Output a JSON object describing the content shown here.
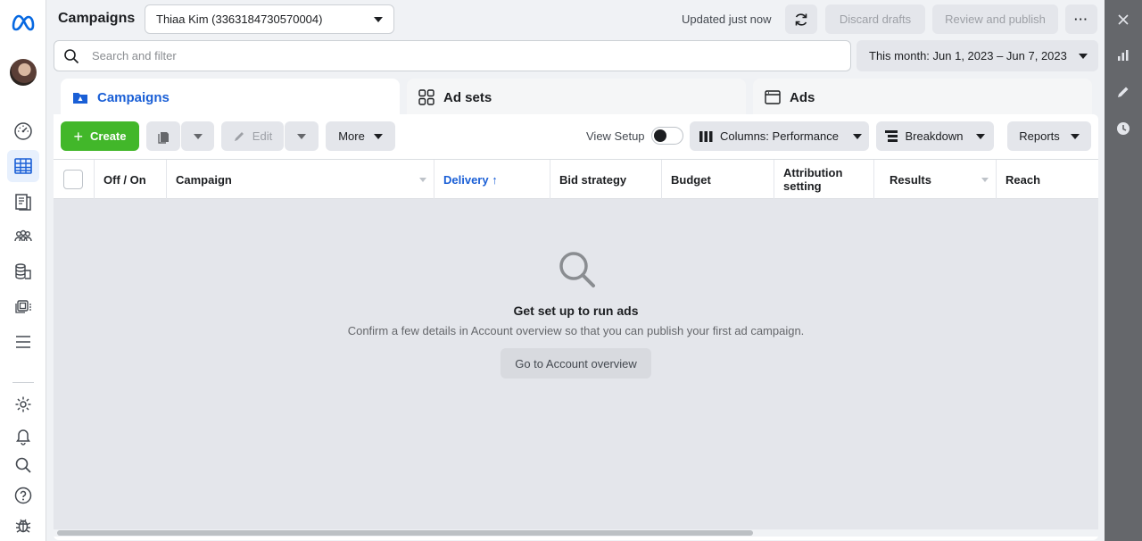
{
  "app": {
    "title": "Campaigns"
  },
  "topbar": {
    "account": "Thiaa Kim (3363184730570004)",
    "status": "Updated just now",
    "discard_label": "Discard drafts",
    "review_label": "Review and publish",
    "more_label": "···"
  },
  "search": {
    "placeholder": "Search and filter"
  },
  "date_range": "This month: Jun 1, 2023 – Jun 7, 2023",
  "tabs": [
    {
      "label": "Campaigns",
      "active": true
    },
    {
      "label": "Ad sets",
      "active": false
    },
    {
      "label": "Ads",
      "active": false
    }
  ],
  "toolbar": {
    "create_label": "Create",
    "edit_label": "Edit",
    "more_label": "More",
    "view_setup_label": "View Setup",
    "columns_label": "Columns: Performance",
    "breakdown_label": "Breakdown",
    "reports_label": "Reports"
  },
  "table": {
    "columns": [
      "Off / On",
      "Campaign",
      "Delivery ↑",
      "Bid strategy",
      "Budget",
      "Attribution setting",
      "Results",
      "Reach"
    ],
    "sorted_column": "Delivery"
  },
  "empty_state": {
    "title": "Get set up to run ads",
    "description": "Confirm a few details in Account overview so that you can publish your first ad campaign.",
    "button_label": "Go to Account overview"
  },
  "colors": {
    "accent": "#1a5fd6",
    "create": "#42b72a",
    "rail": "#65676b"
  }
}
